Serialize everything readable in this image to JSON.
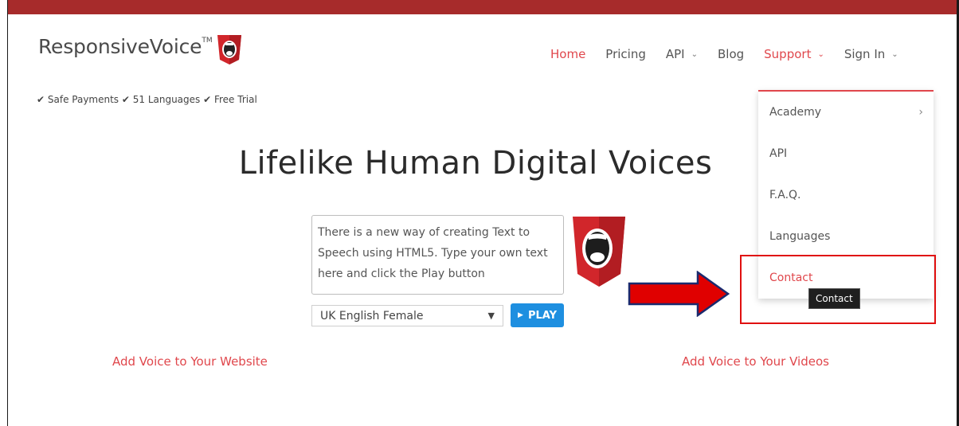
{
  "logo": {
    "text": "ResponsiveVoice",
    "tm": "TM"
  },
  "trust_line": "✔ Safe Payments ✔ 51 Languages ✔ Free Trial",
  "nav": {
    "home": "Home",
    "pricing": "Pricing",
    "api": "API",
    "blog": "Blog",
    "support": "Support",
    "sign_in": "Sign In"
  },
  "dropdown": {
    "items": [
      "Academy",
      "API",
      "F.A.Q.",
      "Languages",
      "Contact"
    ]
  },
  "tooltip": "Contact",
  "headline": "Lifelike Human Digital Voices",
  "demo": {
    "text": "There is a new way of creating Text to Speech using HTML5. Type your own text here and click the Play button",
    "voice": "UK English Female",
    "play_label": "PLAY"
  },
  "links": {
    "website": "Add Voice to Your Website",
    "videos": "Add Voice to Your Videos"
  },
  "colors": {
    "accent": "#e0474c",
    "top_bar": "#a72b2b",
    "play_button": "#1e8fe0",
    "annotation": "#e01010"
  }
}
